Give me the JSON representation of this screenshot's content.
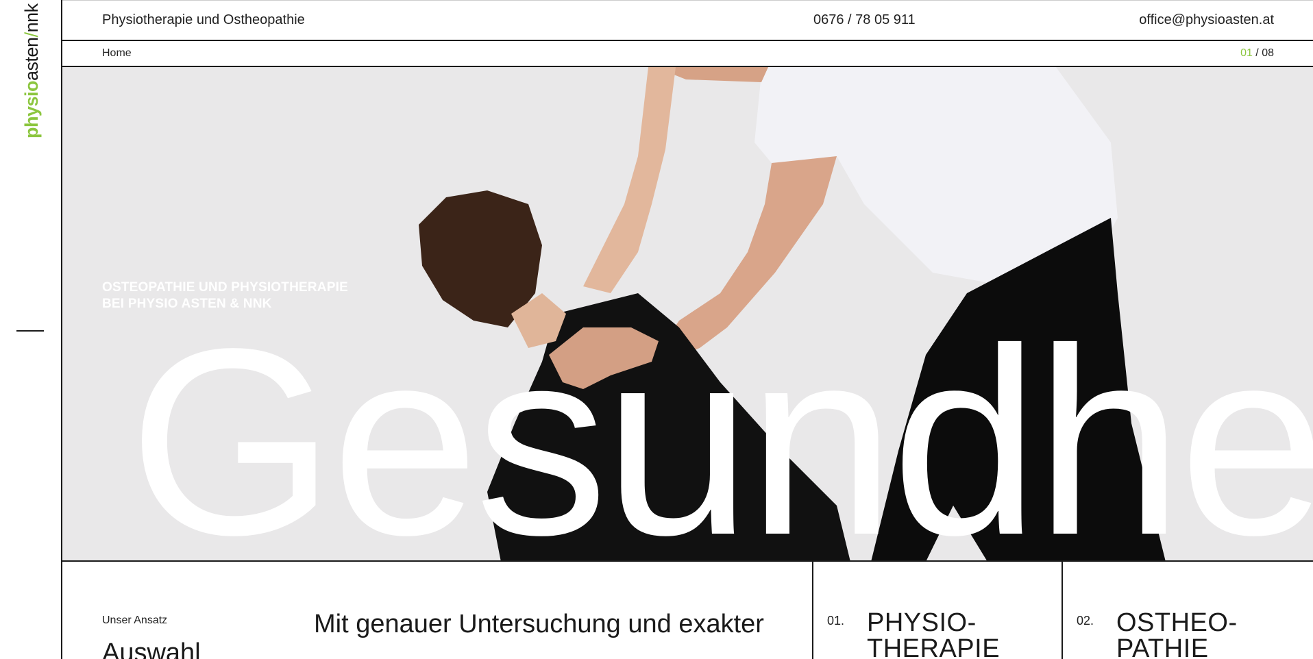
{
  "logo": {
    "part1": "physio",
    "part2": "asten",
    "slash": "/",
    "part3": "nnk",
    "accent_color": "#8cc63f"
  },
  "topbar": {
    "title": "Physiotherapie und Ostheopathie",
    "phone": "0676 / 78 05 911",
    "email": "office@physioasten.at"
  },
  "breadcrumb": {
    "home": "Home"
  },
  "slider": {
    "current": "01",
    "separator": " / ",
    "total": "08"
  },
  "hero": {
    "tagline_line1": "OSTEOPATHIE UND PHYSIOTHERAPIE",
    "tagline_line2": "BEI PHYSIO ASTEN & NNK",
    "big_word": "e Gesundhe"
  },
  "approach": {
    "label": "Unser Ansatz",
    "heading": "Mit genauer Untersuchung und exakter Auswahl"
  },
  "services": [
    {
      "number": "01.",
      "title_line1": "PHYSIO-",
      "title_line2": "THERAPIE"
    },
    {
      "number": "02.",
      "title_line1": "OSTHEO-",
      "title_line2": "PATHIE"
    }
  ]
}
